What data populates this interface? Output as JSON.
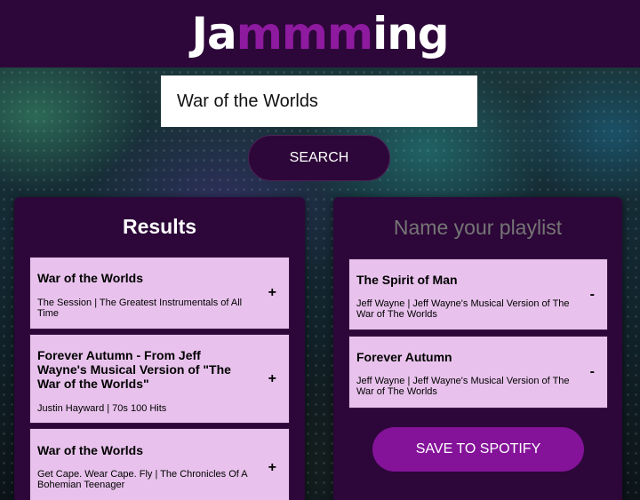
{
  "app": {
    "logo_prefix": "Ja",
    "logo_accent": "mmm",
    "logo_suffix": "ing"
  },
  "search": {
    "value": "War of the Worlds",
    "button_label": "SEARCH"
  },
  "results": {
    "title": "Results",
    "tracks": [
      {
        "name": "War of the Worlds",
        "info": "The Session | The Greatest Instrumentals of All Time",
        "action": "+"
      },
      {
        "name": "Forever Autumn - From Jeff Wayne's Musical Version of \"The War of the Worlds\"",
        "info": "Justin Hayward | 70s 100 Hits",
        "action": "+"
      },
      {
        "name": "War of the Worlds",
        "info": "Get Cape. Wear Cape. Fly | The Chronicles Of A Bohemian Teenager",
        "action": "+"
      }
    ]
  },
  "playlist": {
    "name_placeholder": "Name your playlist",
    "tracks": [
      {
        "name": "The Spirit of Man",
        "info": "Jeff Wayne | Jeff Wayne's Musical Version of The War of The Worlds",
        "action": "-"
      },
      {
        "name": "Forever Autumn",
        "info": "Jeff Wayne | Jeff Wayne's Musical Version of The War of The Worlds",
        "action": "-"
      }
    ],
    "save_label": "SAVE TO SPOTIFY"
  },
  "colors": {
    "header_bg": "#2d0739",
    "accent": "#8e1aa0",
    "track_bg": "#e8c2ec",
    "save_button": "#85139a"
  }
}
